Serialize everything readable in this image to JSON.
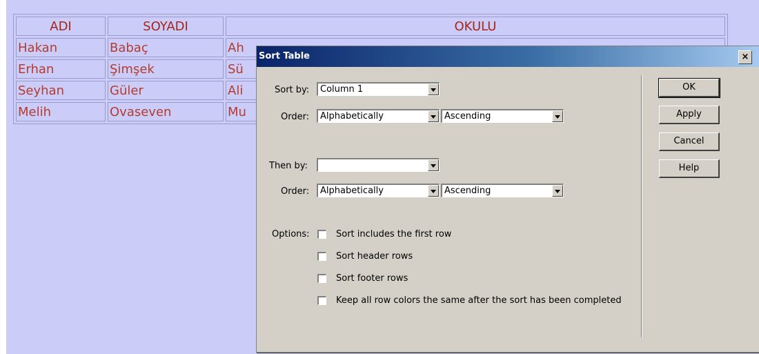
{
  "table": {
    "headers": [
      "ADI",
      "SOYADI",
      "OKULU"
    ],
    "rows": [
      [
        "Hakan",
        "Babaç",
        "Ah"
      ],
      [
        "Erhan",
        "Şimşek",
        "Sü"
      ],
      [
        "Seyhan",
        "Güler",
        "Ali"
      ],
      [
        "Melih",
        "Ovaseven",
        "Mu"
      ]
    ]
  },
  "dialog": {
    "title": "Sort Table",
    "close_label": "×",
    "sort_by_label": "Sort by:",
    "sort_by_value": "Column 1",
    "order_label": "Order:",
    "order1_type": "Alphabetically",
    "order1_direction": "Ascending",
    "then_by_label": "Then by:",
    "then_by_value": "",
    "order2_type": "Alphabetically",
    "order2_direction": "Ascending",
    "options_label": "Options:",
    "options": [
      {
        "label": "Sort includes the first row",
        "checked": false
      },
      {
        "label": "Sort header rows",
        "checked": false
      },
      {
        "label": "Sort footer rows",
        "checked": false
      },
      {
        "label": "Keep all row colors the same after the sort has been completed",
        "checked": false
      }
    ],
    "buttons": {
      "ok": "OK",
      "apply": "Apply",
      "cancel": "Cancel",
      "help": "Help"
    }
  }
}
